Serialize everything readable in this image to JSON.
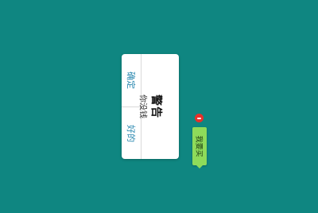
{
  "dialog": {
    "title": "警告",
    "message": "你没钱",
    "confirm_label": "确定",
    "ok_label": "好的"
  },
  "chip": {
    "label": "我要买"
  },
  "badge": {
    "icon": "minus-icon",
    "color": "#e5302a"
  },
  "colors": {
    "background": "#0f8681",
    "button_text": "#2d8ab1",
    "chip": "#8edb5a"
  }
}
